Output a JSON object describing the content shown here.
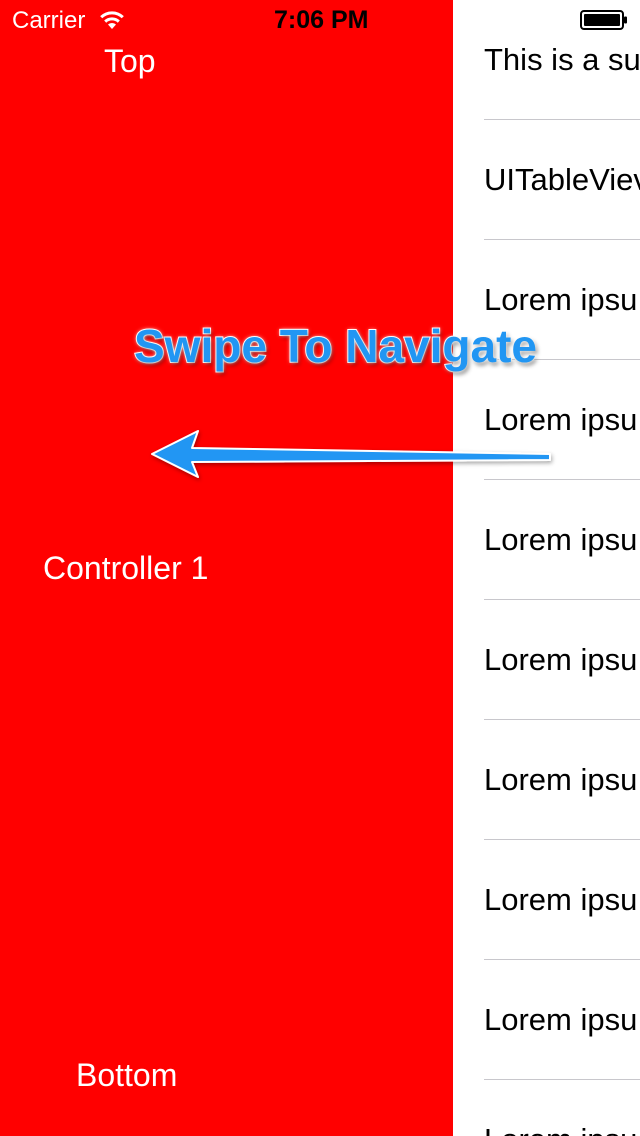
{
  "status_bar": {
    "carrier": "Carrier",
    "time": "7:06 PM"
  },
  "left_panel": {
    "background": "#ff0000",
    "top_label": "Top",
    "center_label": "Controller 1",
    "bottom_label": "Bottom"
  },
  "overlay": {
    "title": "Swipe To Navigate",
    "color": "#2196f3",
    "arrow_direction": "left"
  },
  "table": {
    "rows": [
      "This is a su",
      "UITableViev",
      "Lorem ipsu",
      "Lorem ipsu",
      "Lorem ipsu",
      "Lorem ipsu",
      "Lorem ipsu",
      "Lorem ipsu",
      "Lorem ipsu",
      "Lorem ipsu"
    ]
  }
}
